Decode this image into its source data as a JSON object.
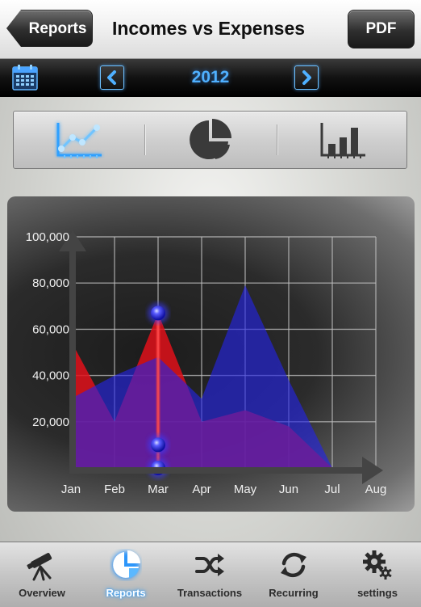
{
  "header": {
    "back_label": "Reports",
    "title": "Incomes vs Expenses",
    "pdf_label": "PDF"
  },
  "year_bar": {
    "year": "2012",
    "calendar_icon": "calendar-icon",
    "prev_icon": "chevron-left-icon",
    "next_icon": "chevron-right-icon"
  },
  "chart_types": [
    {
      "name": "line-chart-icon",
      "selected": true
    },
    {
      "name": "pie-chart-icon",
      "selected": false
    },
    {
      "name": "bar-chart-icon",
      "selected": false
    }
  ],
  "chart_data": {
    "type": "area",
    "categories": [
      "Jan",
      "Feb",
      "Mar",
      "Apr",
      "May",
      "Jun",
      "Jul",
      "Aug"
    ],
    "ylim": [
      0,
      100000
    ],
    "y_ticks": [
      "20,000",
      "40,000",
      "60,000",
      "80,000",
      "100,000"
    ],
    "grid": true,
    "series": [
      {
        "color": "#e0101a",
        "values": [
          55000,
          20000,
          67000,
          20000,
          25000,
          18000,
          0
        ]
      },
      {
        "color": "#2424e8",
        "values": [
          30000,
          40000,
          48000,
          30000,
          79000,
          38000,
          0
        ]
      }
    ],
    "highlight": {
      "category": "Mar",
      "marker_values": [
        67000,
        10000,
        0
      ]
    }
  },
  "tabs": [
    {
      "label": "Overview",
      "icon": "telescope-icon",
      "active": false
    },
    {
      "label": "Reports",
      "icon": "pie-chart-icon",
      "active": true
    },
    {
      "label": "Transactions",
      "icon": "shuffle-icon",
      "active": false
    },
    {
      "label": "Recurring",
      "icon": "refresh-icon",
      "active": false
    },
    {
      "label": "settings",
      "icon": "gears-icon",
      "active": false
    }
  ]
}
